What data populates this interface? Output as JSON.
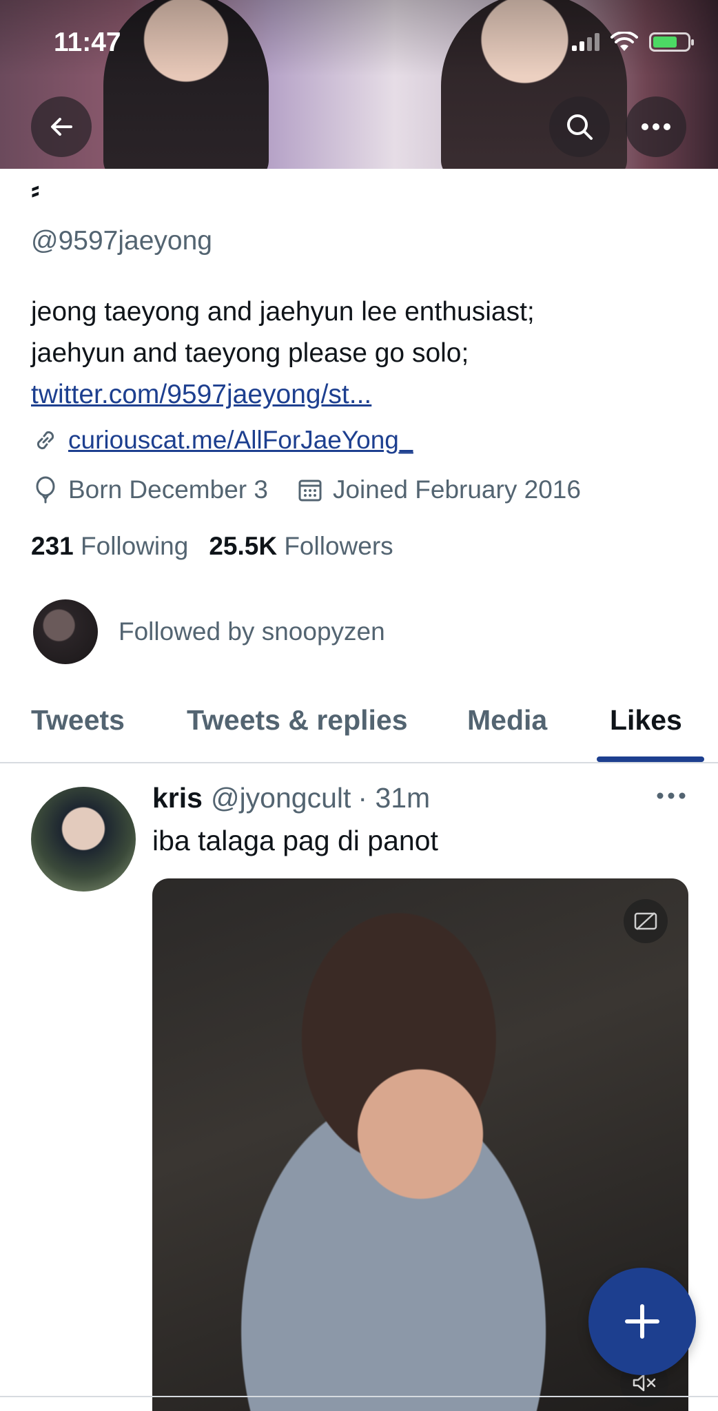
{
  "status_bar": {
    "time": "11:47"
  },
  "profile": {
    "display_name": "⸗",
    "handle": "@9597jaeyong",
    "bio_line1": "jeong taeyong and jaehyun lee enthusiast;",
    "bio_line2": "jaehyun and taeyong please go solo;",
    "bio_link": "twitter.com/9597jaeyong/st...",
    "website": "curiouscat.me/AllForJaeYong_",
    "born": "Born December 3",
    "joined": "Joined February 2016",
    "following_count": "231",
    "following_label": "Following",
    "followers_count": "25.5K",
    "followers_label": "Followers",
    "followed_by": "Followed by snoopyzen"
  },
  "tabs": [
    {
      "label": "Tweets",
      "active": false
    },
    {
      "label": "Tweets & replies",
      "active": false
    },
    {
      "label": "Media",
      "active": false
    },
    {
      "label": "Likes",
      "active": true
    }
  ],
  "tweet": {
    "name": "kris",
    "handle": "@jyongcult",
    "time": "· 31m",
    "text": "iba talaga pag di panot"
  },
  "colors": {
    "accent": "#1d3f8f",
    "secondary_text": "#536471",
    "primary_text": "#0f1419"
  }
}
